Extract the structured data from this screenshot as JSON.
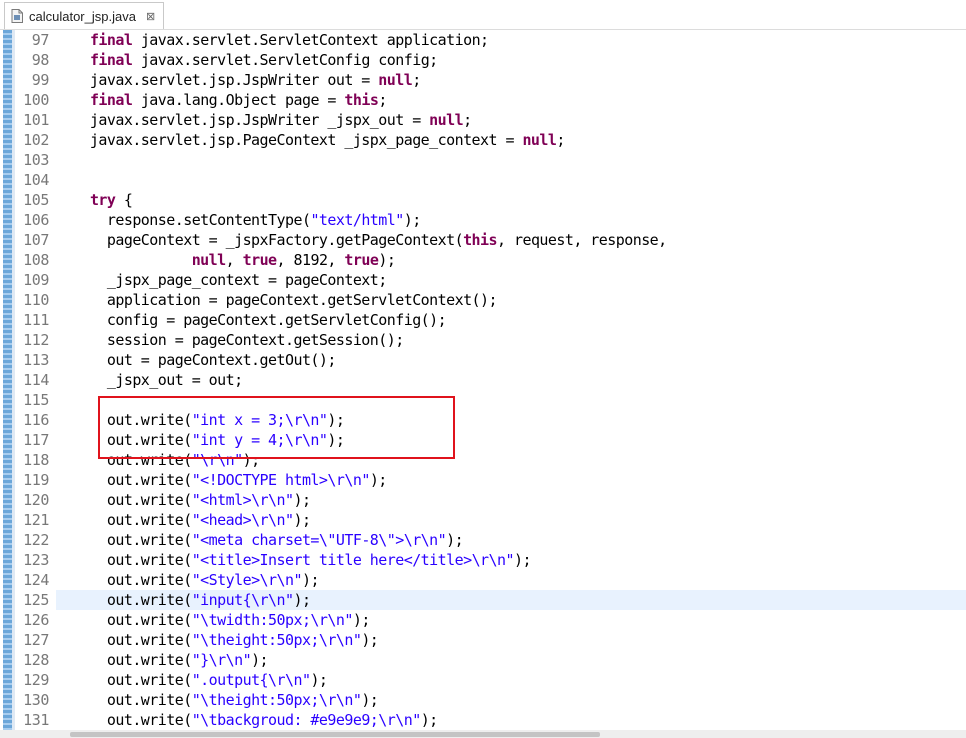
{
  "tab": {
    "title": "calculator_jsp.java",
    "icon": "java-file-icon",
    "close_glyph": "⊠",
    "close_icon": "close-icon"
  },
  "editor": {
    "current_line": 125,
    "keyword_color": "#7f0055",
    "string_color": "#2a00ff",
    "highlight_box_color": "#e0131c",
    "lines": [
      {
        "num": "97",
        "tokens": [
          {
            "t": "    "
          },
          {
            "t": "final",
            "c": "kw"
          },
          {
            "t": " javax.servlet.ServletContext application;"
          }
        ]
      },
      {
        "num": "98",
        "tokens": [
          {
            "t": "    "
          },
          {
            "t": "final",
            "c": "kw"
          },
          {
            "t": " javax.servlet.ServletConfig config;"
          }
        ]
      },
      {
        "num": "99",
        "tokens": [
          {
            "t": "    javax.servlet.jsp.JspWriter out = "
          },
          {
            "t": "null",
            "c": "kw"
          },
          {
            "t": ";"
          }
        ]
      },
      {
        "num": "100",
        "tokens": [
          {
            "t": "    "
          },
          {
            "t": "final",
            "c": "kw"
          },
          {
            "t": " java.lang.Object page = "
          },
          {
            "t": "this",
            "c": "kw"
          },
          {
            "t": ";"
          }
        ]
      },
      {
        "num": "101",
        "tokens": [
          {
            "t": "    javax.servlet.jsp.JspWriter _jspx_out = "
          },
          {
            "t": "null",
            "c": "kw"
          },
          {
            "t": ";"
          }
        ]
      },
      {
        "num": "102",
        "tokens": [
          {
            "t": "    javax.servlet.jsp.PageContext _jspx_page_context = "
          },
          {
            "t": "null",
            "c": "kw"
          },
          {
            "t": ";"
          }
        ]
      },
      {
        "num": "103",
        "tokens": [
          {
            "t": ""
          }
        ]
      },
      {
        "num": "104",
        "tokens": [
          {
            "t": ""
          }
        ]
      },
      {
        "num": "105",
        "tokens": [
          {
            "t": "    "
          },
          {
            "t": "try",
            "c": "kw"
          },
          {
            "t": " {"
          }
        ]
      },
      {
        "num": "106",
        "tokens": [
          {
            "t": "      response.setContentType("
          },
          {
            "t": "\"text/html\"",
            "c": "str"
          },
          {
            "t": ");"
          }
        ]
      },
      {
        "num": "107",
        "tokens": [
          {
            "t": "      pageContext = _jspxFactory.getPageContext("
          },
          {
            "t": "this",
            "c": "kw"
          },
          {
            "t": ", request, response,"
          }
        ]
      },
      {
        "num": "108",
        "tokens": [
          {
            "t": "                "
          },
          {
            "t": "null",
            "c": "kw"
          },
          {
            "t": ", "
          },
          {
            "t": "true",
            "c": "kw"
          },
          {
            "t": ", 8192, "
          },
          {
            "t": "true",
            "c": "kw"
          },
          {
            "t": ");"
          }
        ]
      },
      {
        "num": "109",
        "tokens": [
          {
            "t": "      _jspx_page_context = pageContext;"
          }
        ]
      },
      {
        "num": "110",
        "tokens": [
          {
            "t": "      application = pageContext.getServletContext();"
          }
        ]
      },
      {
        "num": "111",
        "tokens": [
          {
            "t": "      config = pageContext.getServletConfig();"
          }
        ]
      },
      {
        "num": "112",
        "tokens": [
          {
            "t": "      session = pageContext.getSession();"
          }
        ]
      },
      {
        "num": "113",
        "tokens": [
          {
            "t": "      out = pageContext.getOut();"
          }
        ]
      },
      {
        "num": "114",
        "tokens": [
          {
            "t": "      _jspx_out = out;"
          }
        ]
      },
      {
        "num": "115",
        "tokens": [
          {
            "t": ""
          }
        ]
      },
      {
        "num": "116",
        "tokens": [
          {
            "t": "      out.write("
          },
          {
            "t": "\"int x = 3;\\r\\n\"",
            "c": "str"
          },
          {
            "t": ");"
          }
        ]
      },
      {
        "num": "117",
        "tokens": [
          {
            "t": "      out.write("
          },
          {
            "t": "\"int y = 4;\\r\\n\"",
            "c": "str"
          },
          {
            "t": ");"
          }
        ]
      },
      {
        "num": "118",
        "tokens": [
          {
            "t": "      out.write("
          },
          {
            "t": "\"\\r\\n\"",
            "c": "str"
          },
          {
            "t": ");"
          }
        ]
      },
      {
        "num": "119",
        "tokens": [
          {
            "t": "      out.write("
          },
          {
            "t": "\"<!DOCTYPE html>\\r\\n\"",
            "c": "str"
          },
          {
            "t": ");"
          }
        ]
      },
      {
        "num": "120",
        "tokens": [
          {
            "t": "      out.write("
          },
          {
            "t": "\"<html>\\r\\n\"",
            "c": "str"
          },
          {
            "t": ");"
          }
        ]
      },
      {
        "num": "121",
        "tokens": [
          {
            "t": "      out.write("
          },
          {
            "t": "\"<head>\\r\\n\"",
            "c": "str"
          },
          {
            "t": ");"
          }
        ]
      },
      {
        "num": "122",
        "tokens": [
          {
            "t": "      out.write("
          },
          {
            "t": "\"<meta charset=\\\"UTF-8\\\">\\r\\n\"",
            "c": "str"
          },
          {
            "t": ");"
          }
        ]
      },
      {
        "num": "123",
        "tokens": [
          {
            "t": "      out.write("
          },
          {
            "t": "\"<title>Insert title here</title>\\r\\n\"",
            "c": "str"
          },
          {
            "t": ");"
          }
        ]
      },
      {
        "num": "124",
        "tokens": [
          {
            "t": "      out.write("
          },
          {
            "t": "\"<Style>\\r\\n\"",
            "c": "str"
          },
          {
            "t": ");"
          }
        ]
      },
      {
        "num": "125",
        "tokens": [
          {
            "t": "      out.write("
          },
          {
            "t": "\"input{\\r\\n\"",
            "c": "str"
          },
          {
            "t": ");"
          }
        ]
      },
      {
        "num": "126",
        "tokens": [
          {
            "t": "      out.write("
          },
          {
            "t": "\"\\twidth:50px;\\r\\n\"",
            "c": "str"
          },
          {
            "t": ");"
          }
        ]
      },
      {
        "num": "127",
        "tokens": [
          {
            "t": "      out.write("
          },
          {
            "t": "\"\\theight:50px;\\r\\n\"",
            "c": "str"
          },
          {
            "t": ");"
          }
        ]
      },
      {
        "num": "128",
        "tokens": [
          {
            "t": "      out.write("
          },
          {
            "t": "\"}\\r\\n\"",
            "c": "str"
          },
          {
            "t": ");"
          }
        ]
      },
      {
        "num": "129",
        "tokens": [
          {
            "t": "      out.write("
          },
          {
            "t": "\".output{\\r\\n\"",
            "c": "str"
          },
          {
            "t": ");"
          }
        ]
      },
      {
        "num": "130",
        "tokens": [
          {
            "t": "      out.write("
          },
          {
            "t": "\"\\theight:50px;\\r\\n\"",
            "c": "str"
          },
          {
            "t": ");"
          }
        ]
      },
      {
        "num": "131",
        "tokens": [
          {
            "t": "      out.write("
          },
          {
            "t": "\"\\tbackgroud: #e9e9e9;\\r\\n\"",
            "c": "str"
          },
          {
            "t": ");"
          }
        ]
      }
    ]
  }
}
